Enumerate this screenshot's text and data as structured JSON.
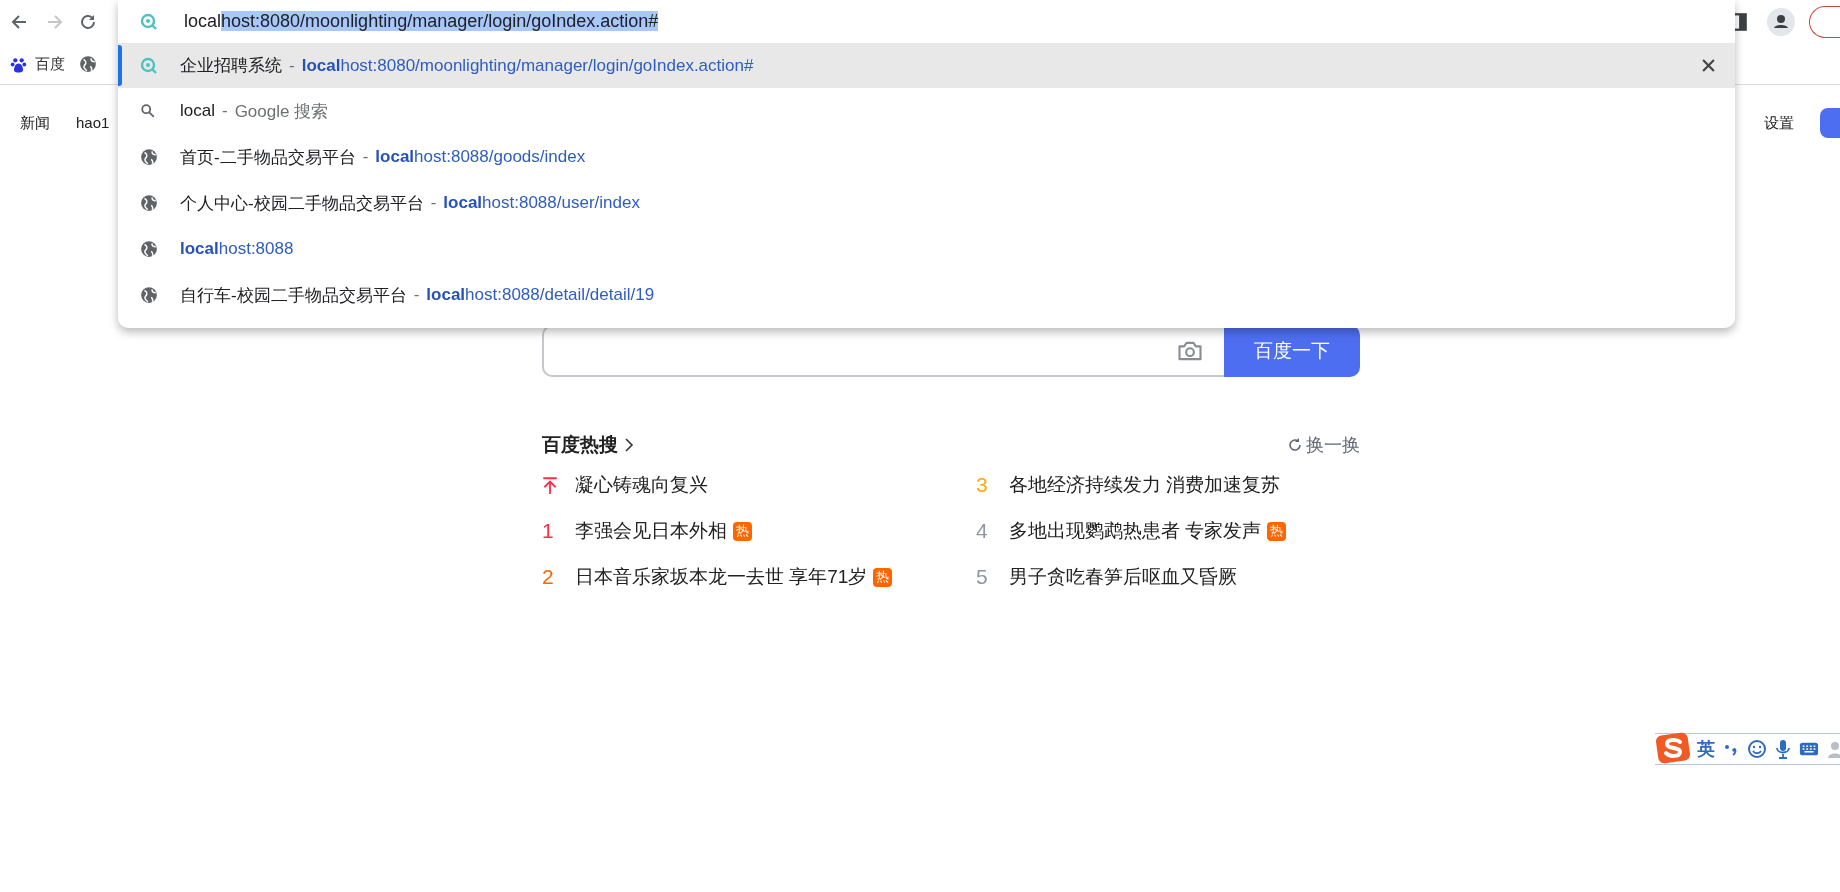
{
  "omnibox": {
    "typed": "local",
    "completion": "host:8080/moonlighting/manager/login/goIndex.action#"
  },
  "suggestions": [
    {
      "kind": "site",
      "title": "企业招聘系统",
      "sep": "-",
      "url": "**local**host:8080/moonlighting/manager/login/goIndex.action#",
      "selected": true
    },
    {
      "kind": "search",
      "title": "local",
      "sep": "-",
      "suffix": "Google 搜索",
      "selected": false
    },
    {
      "kind": "history",
      "title": "首页-二手物品交易平台",
      "sep": "-",
      "url": "**local**host:8088/goods/index",
      "selected": false
    },
    {
      "kind": "history",
      "title": "个人中心-校园二手物品交易平台",
      "sep": "-",
      "url": "**local**host:8088/user/index",
      "selected": false
    },
    {
      "kind": "history",
      "url": "**local**host:8088",
      "selected": false
    },
    {
      "kind": "history",
      "title": "自行车-校园二手物品交易平台",
      "sep": "-",
      "url": "**local**host:8088/detail/detail/19",
      "selected": false
    }
  ],
  "bookmarks": [
    {
      "kind": "baidu",
      "label": "百度"
    },
    {
      "kind": "globe"
    }
  ],
  "nav": {
    "left": [
      "新闻",
      "hao1"
    ],
    "right": [
      "设置"
    ]
  },
  "search": {
    "button": "百度一下"
  },
  "hot": {
    "title": "百度热搜",
    "refresh": "换一换",
    "items": [
      {
        "kind": "pinned",
        "text": "凝心铸魂向复兴",
        "color": "#fe2d46"
      },
      {
        "kind": "ranked",
        "rank": "1",
        "text": "李强会见日本外相",
        "badge": "热",
        "color": "#fe2d46"
      },
      {
        "kind": "ranked",
        "rank": "2",
        "text": "日本音乐家坂本龙一去世 享年71岁",
        "badge": "热",
        "color": "#ff6600"
      },
      {
        "kind": "ranked",
        "rank": "3",
        "text": "各地经济持续发力 消费加速复苏",
        "color": "#faa90e"
      },
      {
        "kind": "ranked",
        "rank": "4",
        "text": "多地出现鹦鹉热患者 专家发声",
        "badge": "热",
        "color": "#9195a3"
      },
      {
        "kind": "ranked",
        "rank": "5",
        "text": "男子贪吃春笋后呕血又昏厥",
        "color": "#9195a3"
      }
    ]
  },
  "ime": {
    "mode": "英"
  }
}
